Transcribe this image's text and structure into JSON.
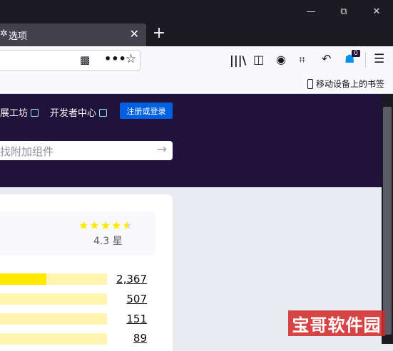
{
  "window": {
    "minimize": "—",
    "maximize": "⧉",
    "close": "✕"
  },
  "tab": {
    "title": "选项",
    "close": "✕",
    "new_tab": "+"
  },
  "toolbar": {
    "badge_count": "0"
  },
  "bookmarks": {
    "mobile_label": "移动设备上的书签"
  },
  "header": {
    "link_workshop": "展工坊",
    "link_dev_hub": "开发者中心",
    "login_button": "注册或登录",
    "search_placeholder": "找附加组件"
  },
  "rating": {
    "stars": "★★★★",
    "half_star": "★",
    "value_text": "4.3 星",
    "average": 4.3,
    "bars": [
      {
        "count": "2,367",
        "fraction": 0.43
      },
      {
        "count": "507",
        "fraction": 0.0
      },
      {
        "count": "151",
        "fraction": 0.0
      },
      {
        "count": "89",
        "fraction": 0.0
      }
    ]
  },
  "colors": {
    "accent": "#0060df",
    "header_bg": "#20123a",
    "star": "#ffe900"
  },
  "watermark": "宝哥软件园"
}
